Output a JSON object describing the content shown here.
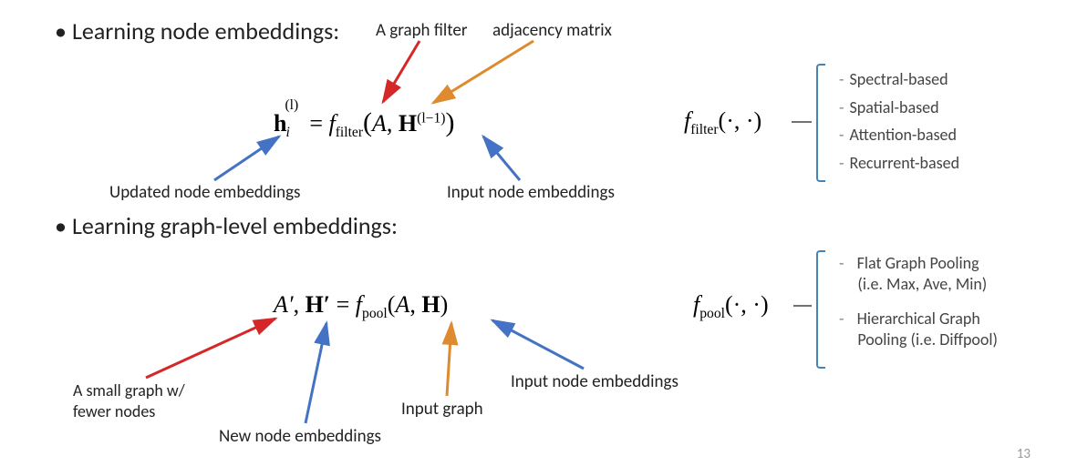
{
  "headings": {
    "node": "Learning node embeddings:",
    "graph": "Learning graph-level embeddings:"
  },
  "annotations": {
    "graph_filter": "A graph filter",
    "adjacency": "adjacency matrix",
    "updated_node": "Updated node embeddings",
    "input_node1": "Input node embeddings",
    "small_graph_l1": "A small graph w/",
    "small_graph_l2": "fewer nodes",
    "new_node": "New node embeddings",
    "input_graph": "Input graph",
    "input_node2": "Input node embeddings"
  },
  "eq1": {
    "lhs_h": "h",
    "lhs_sub": "i",
    "lhs_sup": "(l)",
    "eq": " = ",
    "fn_f": "f",
    "fn_sub": "filter",
    "open": "(",
    "arg_A": "A",
    "comma": ", ",
    "arg_H": "H",
    "arg_H_sup": "(l−1)",
    "close": ")"
  },
  "eq1_right": {
    "fn_f": "f",
    "fn_sub": "filter",
    "args": "(·, ·)"
  },
  "filter_cats": {
    "a": "Spectral-based",
    "b": "Spatial-based",
    "c": "Attention-based",
    "d": "Recurrent-based"
  },
  "eq2": {
    "lhs_Ap": "A′",
    "comma1": ", ",
    "lhs_Hp": "H′",
    "eq": " = ",
    "fn_f": "f",
    "fn_sub": "pool",
    "open": "(",
    "arg_A": "A",
    "comma2": ", ",
    "arg_H": "H",
    "close": ")"
  },
  "eq2_right": {
    "fn_f": "f",
    "fn_sub": "pool",
    "args": "(·, ·)"
  },
  "pool_cats": {
    "a_l1": "Flat Graph Pooling",
    "a_l2": "(i.e. Max, Ave, Min)",
    "b_l1": "Hierarchical Graph",
    "b_l2": "Pooling (i.e. Diffpool)"
  },
  "page_number": "13"
}
